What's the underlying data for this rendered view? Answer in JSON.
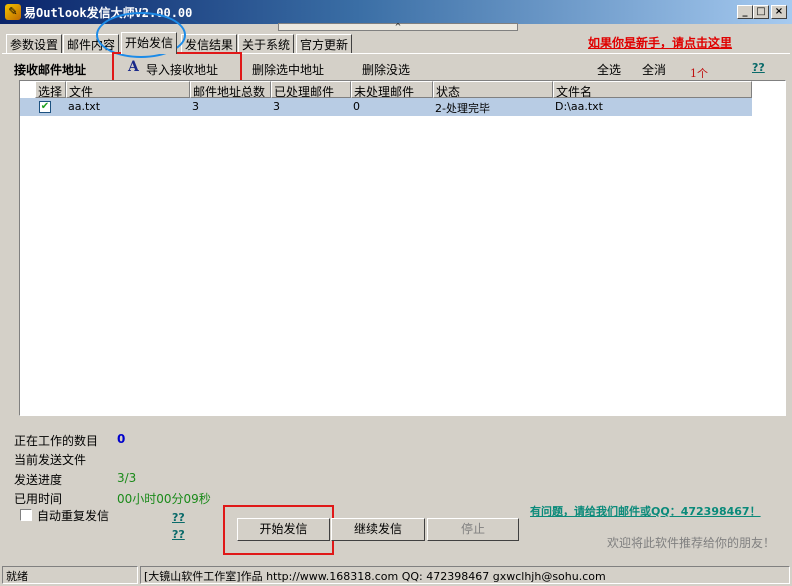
{
  "window": {
    "title": "易Outlook发信大师V2.00.00",
    "minimize": "_",
    "maximize": "□",
    "close": "×",
    "gripper": "^"
  },
  "tabs": [
    {
      "label": "参数设置"
    },
    {
      "label": "邮件内容"
    },
    {
      "label": "开始发信"
    },
    {
      "label": "发信结果"
    },
    {
      "label": "关于系统"
    },
    {
      "label": "官方更新"
    }
  ],
  "newbie_link": "如果你是新手，请点击这里",
  "toolbar": {
    "section_label": "接收邮件地址",
    "import_icon": "A",
    "import_label": "导入接收地址",
    "delete_selected": "删除选中地址",
    "delete_unchecked": "删除没选",
    "select_all": "全选",
    "deselect_all": "全消",
    "count": "1个",
    "help": "??"
  },
  "list": {
    "columns": [
      "选择",
      "文件",
      "邮件地址总数",
      "已处理邮件",
      "未处理邮件",
      "状态",
      "文件名"
    ],
    "rows": [
      {
        "checked": true,
        "file": "aa.txt",
        "total": "3",
        "processed": "3",
        "unprocessed": "0",
        "status": "2-处理完毕",
        "filename": "D:\\aa.txt"
      }
    ]
  },
  "info": {
    "working_count_label": "正在工作的数目",
    "working_count_value": "0",
    "current_file_label": "当前发送文件",
    "progress_label": "发送进度",
    "progress_value": "3/3",
    "elapsed_label": "已用时间",
    "elapsed_value": "00小时00分09秒",
    "auto_repeat_label": "自动重复发信",
    "help1": "??",
    "help2": "??"
  },
  "buttons": {
    "start": "开始发信",
    "continue": "继续发信",
    "stop": "停止"
  },
  "help_link": "有问题，请给我们邮件或QQ：472398467！",
  "recommend": "欢迎将此软件推荐给你的朋友！",
  "statusbar": {
    "state": "就绪",
    "credits": "[大镜山软件工作室]作品 http://www.168318.com QQ: 472398467 gxwclhjh@sohu.com"
  },
  "colors": {
    "title_bar_start": "#0a246a",
    "highlight_red": "#e01818",
    "highlight_blue": "#1c8be8",
    "selected_row": "#b8cce4",
    "link_red": "#e00000",
    "link_teal": "#0a8a7a",
    "value_blue": "#0000cc",
    "value_green": "#1a8a1a"
  }
}
